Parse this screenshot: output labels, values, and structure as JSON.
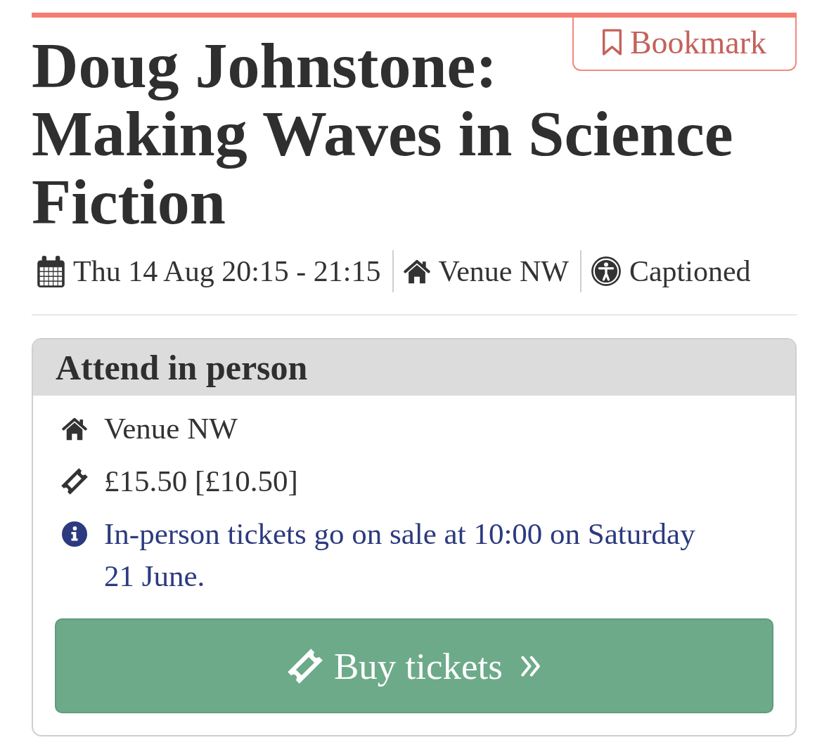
{
  "bookmark_button": {
    "label": "Bookmark"
  },
  "title_lines": [
    "Doug Johnstone:",
    "Making Waves in Science",
    "Fiction"
  ],
  "meta": [
    {
      "kind": "date",
      "text": "Thu 14 Aug 20:15 - 21:15"
    },
    {
      "kind": "venue",
      "text": "Venue NW"
    },
    {
      "kind": "access",
      "text": "Captioned"
    }
  ],
  "booking_card": {
    "heading": "Attend in person",
    "details": [
      {
        "kind": "venue",
        "text": "Venue NW"
      },
      {
        "kind": "price",
        "text": "£15.50 [£10.50]"
      },
      {
        "kind": "notice",
        "text": "In-person tickets go on sale at 10:00 on Saturday 21 June."
      }
    ],
    "button": {
      "label": "Buy tickets"
    }
  }
}
